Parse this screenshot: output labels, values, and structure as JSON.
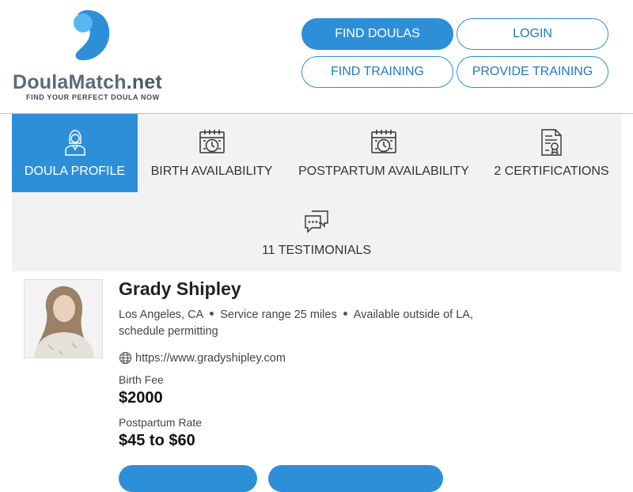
{
  "brand": {
    "name_main": "DoulaMatch",
    "name_suffix": ".net",
    "tagline": "FIND YOUR PERFECT DOULA NOW"
  },
  "nav": {
    "find_doulas": "FIND DOULAS",
    "login": "LOGIN",
    "find_training": "FIND TRAINING",
    "provide_training": "PROVIDE TRAINING"
  },
  "tabs": [
    {
      "label": "DOULA PROFILE",
      "icon": "person-icon",
      "active": true
    },
    {
      "label": "BIRTH AVAILABILITY",
      "icon": "calendar-clock-icon",
      "active": false
    },
    {
      "label": "POSTPARTUM AVAILABILITY",
      "icon": "calendar-clock-icon",
      "active": false
    },
    {
      "label": "2 CERTIFICATIONS",
      "icon": "certificate-icon",
      "active": false
    },
    {
      "label": "11 TESTIMONIALS",
      "icon": "chat-bubbles-icon",
      "active": false
    }
  ],
  "profile": {
    "name": "Grady Shipley",
    "location": "Los Angeles, CA",
    "service_range": "Service range 25 miles",
    "availability_note": "Available outside of LA, schedule permitting",
    "website": "https://www.gradyshipley.com",
    "birth_fee_label": "Birth Fee",
    "birth_fee": "$2000",
    "postpartum_label": "Postpartum Rate",
    "postpartum_rate": "$45 to $60"
  },
  "colors": {
    "accent": "#2e8fd9",
    "tab_bg": "#f2f2f2",
    "logo_dark": "#2e8fd9",
    "logo_light": "#56b7f2"
  }
}
